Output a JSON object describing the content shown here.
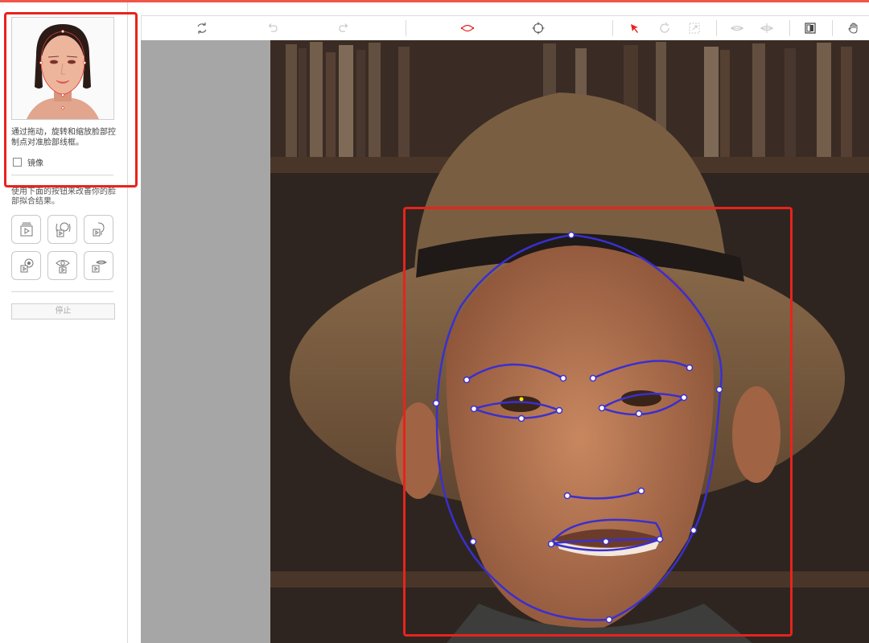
{
  "sidebar": {
    "instruction": "通过拖动，旋转和缩放脸部控制点对准脸部线框。",
    "mirror_label": "镜像",
    "mirror_checked": false,
    "auto_instruction": "使用下面的按钮来改善你的脸部拟合结果。",
    "tool_icons": [
      "fit-face-icon",
      "fit-head-icon",
      "fit-profile-icon",
      "fit-ear-icon",
      "fit-eye-icon",
      "fit-mouth-icon"
    ],
    "stop_label": "停止"
  },
  "toolbar": {
    "tools": [
      {
        "name": "reset-icon",
        "enabled": true
      },
      {
        "name": "undo-icon",
        "enabled": false
      },
      {
        "name": "redo-icon",
        "enabled": false
      },
      {
        "name": "wireframe-eye-icon",
        "enabled": true,
        "active": true
      },
      {
        "name": "move-points-icon",
        "enabled": true
      },
      {
        "name": "select-arrow-icon",
        "enabled": true,
        "active": true
      },
      {
        "name": "rotate-icon",
        "enabled": false
      },
      {
        "name": "scale-icon",
        "enabled": false
      },
      {
        "name": "flip-horizontal-icon",
        "enabled": false
      },
      {
        "name": "flip-vertical-icon",
        "enabled": false
      },
      {
        "name": "contrast-icon",
        "enabled": true
      },
      {
        "name": "hand-pan-icon",
        "enabled": true
      }
    ]
  },
  "colors": {
    "highlight": "#e8231c",
    "wireframe": "#3a2fd0",
    "accent": "#f0554a"
  }
}
